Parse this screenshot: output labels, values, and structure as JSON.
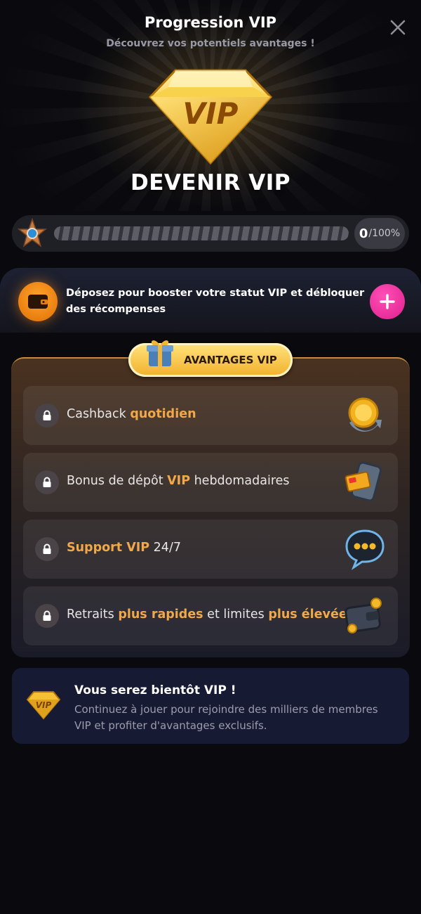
{
  "header": {
    "title": "Progression VIP",
    "subtitle": "Découvrez vos potentiels avantages !",
    "close_icon": "close-icon"
  },
  "hero": {
    "badge_text": "VIP",
    "cta_title": "DEVENIR VIP"
  },
  "progress": {
    "current": "0",
    "max": "/100%",
    "fraction": 0,
    "badge_icon": "star-badge-icon"
  },
  "deposit": {
    "text": "Déposez pour booster votre statut VIP et débloquer des récompenses",
    "icon": "wallet-icon",
    "button_icon": "plus-icon"
  },
  "benefits": {
    "title": "AVANTAGES VIP",
    "items": [
      {
        "parts": [
          "Cashback ",
          "quotidien"
        ],
        "icon": "coin-cashback-icon"
      },
      {
        "parts": [
          "Bonus de dépôt ",
          "VIP",
          " hebdomadaires"
        ],
        "icon": "phone-card-icon"
      },
      {
        "parts": [
          "Support VIP",
          " 24/7"
        ],
        "icon": "chat-bubble-icon"
      },
      {
        "parts": [
          "Retraits ",
          "plus rapides",
          " et limites ",
          "plus élevées"
        ],
        "icon": "wallet-coins-icon"
      }
    ]
  },
  "soon": {
    "title": "Vous serez bientôt VIP !",
    "description": "Continuez à jouer pour rejoindre des milliers de membres VIP et profiter d'avantages exclusifs.",
    "badge_text": "VIP"
  },
  "colors": {
    "background": "#0a0a0e",
    "accent_gold": "#f0a84a",
    "plus_pink": "#e0208d",
    "wallet_orange": "#ff8c14"
  }
}
